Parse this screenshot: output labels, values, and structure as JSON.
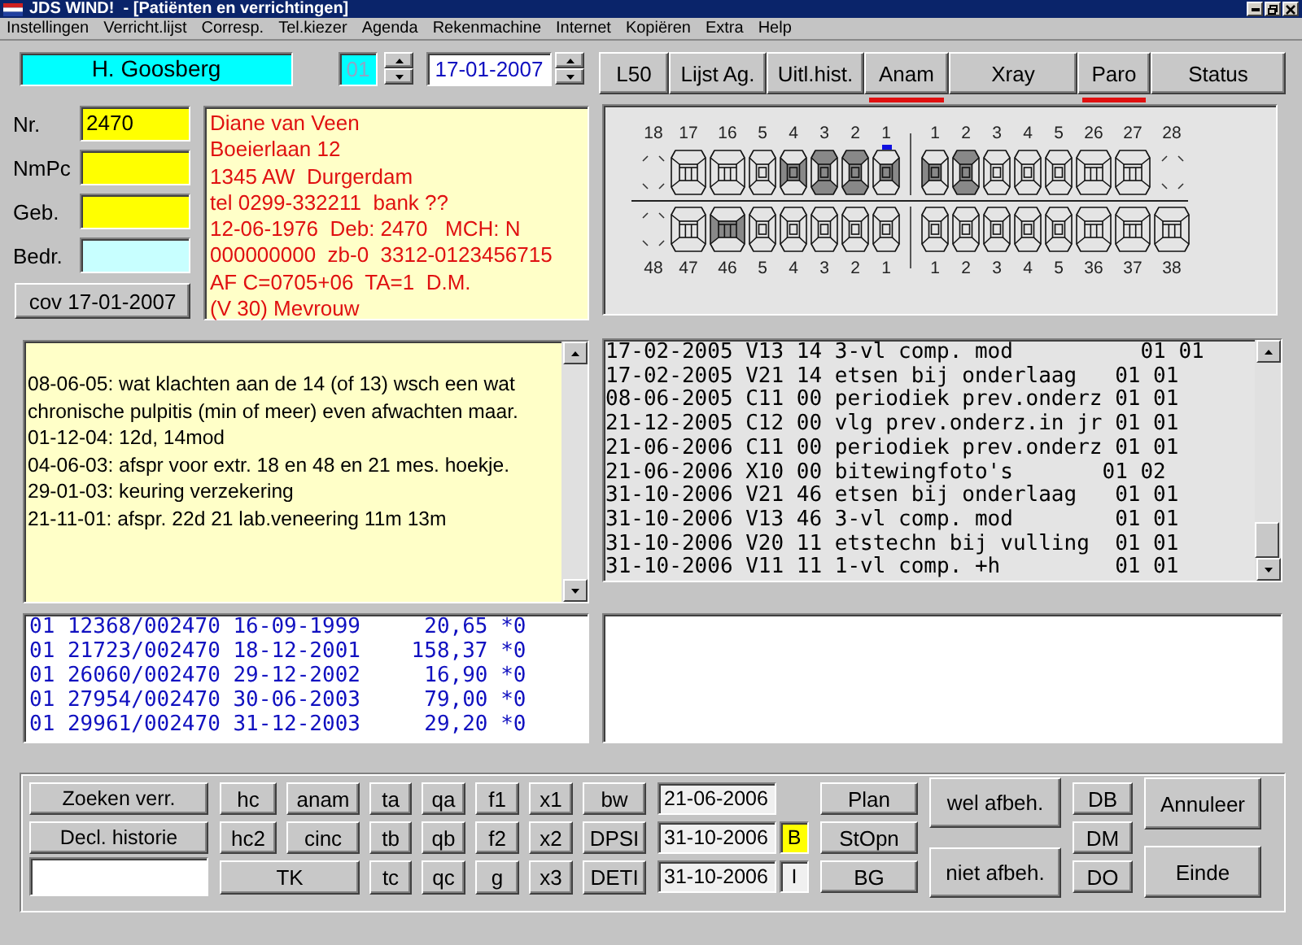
{
  "window": {
    "title": "JDS WIND!  - [Patiënten en verrichtingen]"
  },
  "menu": [
    {
      "label": "Instellingen"
    },
    {
      "label": "Verricht.lijst"
    },
    {
      "label": "Corresp."
    },
    {
      "label": "Tel.kiezer"
    },
    {
      "label": "Agenda"
    },
    {
      "label": "Rekenmachine"
    },
    {
      "label": "Internet"
    },
    {
      "label": "Kopiëren"
    },
    {
      "label": "Extra"
    },
    {
      "label": "Help"
    }
  ],
  "header": {
    "practitioner": "H. Goosberg",
    "counter": "01",
    "date": "17-01-2007"
  },
  "tabs": [
    {
      "label": "L50",
      "flagged": false
    },
    {
      "label": "Lijst Ag.",
      "flagged": false
    },
    {
      "label": "Uitl.hist.",
      "flagged": false
    },
    {
      "label": "Anam",
      "flagged": true
    },
    {
      "label": "Xray",
      "flagged": false
    },
    {
      "label": "Paro",
      "flagged": true
    },
    {
      "label": "Status",
      "flagged": false
    }
  ],
  "fields": [
    {
      "label": "Nr.",
      "value": "2470",
      "color": "#ffff00"
    },
    {
      "label": "NmPc",
      "color": "#ffff00"
    },
    {
      "label": "Geb.",
      "color": "#ffff00"
    },
    {
      "label": "Bedr.",
      "color": "#c8ffff"
    }
  ],
  "cov_button": "cov 17-01-2007",
  "address_lines": [
    "Diane van Veen",
    "Boeierlaan 12",
    "1345 AW  Durgerdam",
    "tel 0299-332211  bank ??",
    "12-06-1976  Deb: 2470   MCH: N",
    "000000000  zb-0  3312-0123456715",
    "AF C=0705+06  TA=1  D.M.",
    "(V 30) Mevrouw"
  ],
  "dental_chart": {
    "upper": [
      {
        "label": "18",
        "kind": "missing",
        "selected": false
      },
      {
        "label": "17",
        "kind": "molar",
        "selected": false
      },
      {
        "label": "16",
        "kind": "molar",
        "selected": false
      },
      {
        "label": "5",
        "kind": "premolar",
        "selected": false
      },
      {
        "label": "4",
        "kind": "premolar-band",
        "selected": false
      },
      {
        "label": "3",
        "kind": "premolar-pattern",
        "selected": false
      },
      {
        "label": "2",
        "kind": "premolar-pattern",
        "selected": false
      },
      {
        "label": "1",
        "kind": "premolar-right",
        "selected": true
      },
      {
        "label": "1",
        "kind": "premolar-left",
        "selected": false
      },
      {
        "label": "2",
        "kind": "premolar-pattern",
        "selected": false
      },
      {
        "label": "3",
        "kind": "premolar",
        "selected": false
      },
      {
        "label": "4",
        "kind": "premolar",
        "selected": false
      },
      {
        "label": "5",
        "kind": "premolar",
        "selected": false
      },
      {
        "label": "26",
        "kind": "molar",
        "selected": false
      },
      {
        "label": "27",
        "kind": "molar",
        "selected": false
      },
      {
        "label": "28",
        "kind": "missing",
        "selected": false
      }
    ],
    "lower": [
      {
        "label": "48",
        "kind": "missing",
        "selected": false
      },
      {
        "label": "47",
        "kind": "molar",
        "selected": false
      },
      {
        "label": "46",
        "kind": "molar-band",
        "selected": false
      },
      {
        "label": "5",
        "kind": "premolar",
        "selected": false
      },
      {
        "label": "4",
        "kind": "premolar",
        "selected": false
      },
      {
        "label": "3",
        "kind": "premolar",
        "selected": false
      },
      {
        "label": "2",
        "kind": "premolar",
        "selected": false
      },
      {
        "label": "1",
        "kind": "premolar",
        "selected": false
      },
      {
        "label": "1",
        "kind": "premolar",
        "selected": false
      },
      {
        "label": "2",
        "kind": "premolar",
        "selected": false
      },
      {
        "label": "3",
        "kind": "premolar",
        "selected": false
      },
      {
        "label": "4",
        "kind": "premolar",
        "selected": false
      },
      {
        "label": "5",
        "kind": "premolar",
        "selected": false
      },
      {
        "label": "36",
        "kind": "molar",
        "selected": false
      },
      {
        "label": "37",
        "kind": "molar",
        "selected": false
      },
      {
        "label": "38",
        "kind": "molar",
        "selected": false
      }
    ]
  },
  "notes": [
    "08-06-05: wat klachten aan de 14 (of 13) wsch een wat",
    "chronische pulpitis (min of meer) even afwachten maar.",
    "01-12-04: 12d, 14mod",
    "04-06-03: afspr voor extr. 18 en 48 en 21 mes. hoekje.",
    "29-01-03: keuring verzekering",
    "21-11-01: afspr. 22d 21 lab.veneering 11m 13m"
  ],
  "treatments": [
    "17-02-2005 V13 14 3-vl comp. mod          01 01",
    "17-02-2005 V21 14 etsen bij onderlaag   01 01",
    "08-06-2005 C11 00 periodiek prev.onderz 01 01",
    "21-12-2005 C12 00 vlg prev.onderz.in jr 01 01",
    "21-06-2006 C11 00 periodiek prev.onderz 01 01",
    "21-06-2006 X10 00 bitewingfoto's       01 02",
    "31-10-2006 V21 46 etsen bij onderlaag   01 01",
    "31-10-2006 V13 46 3-vl comp. mod        01 01",
    "31-10-2006 V20 11 etstechn bij vulling  01 01",
    "31-10-2006 V11 11 1-vl comp. +h         01 01"
  ],
  "invoices": [
    "01 12368/002470 16-09-1999     20,65 *0",
    "01 21723/002470 18-12-2001    158,37 *0",
    "01 26060/002470 29-12-2002     16,90 *0",
    "01 27954/002470 30-06-2003     79,00 *0",
    "01 29961/002470 31-12-2003     29,20 *0"
  ],
  "bottom": {
    "search_buttons": [
      "Zoeken verr.",
      "Decl. historie"
    ],
    "code_buttons": [
      [
        "hc",
        "anam",
        "ta",
        "qa",
        "f1",
        "x1",
        "bw"
      ],
      [
        "hc2",
        "cinc",
        "tb",
        "qb",
        "f2",
        "x2",
        "DPSI"
      ],
      [
        "TK",
        "tc",
        "qc",
        "g",
        "x3",
        "DETI"
      ]
    ],
    "dates": [
      {
        "value": "21-06-2006"
      },
      {
        "value": "31-10-2006",
        "flag": "B",
        "highlighted": true
      },
      {
        "value": "31-10-2006",
        "flag": "I",
        "highlighted": false
      }
    ],
    "plan_buttons": [
      "Plan",
      "StOpn",
      "BG"
    ],
    "treatment_buttons": [
      "wel afbeh.",
      "niet afbeh."
    ],
    "d_buttons": [
      "DB",
      "DM",
      "DO"
    ],
    "dialog_buttons": [
      "Annuleer",
      "Einde"
    ]
  }
}
